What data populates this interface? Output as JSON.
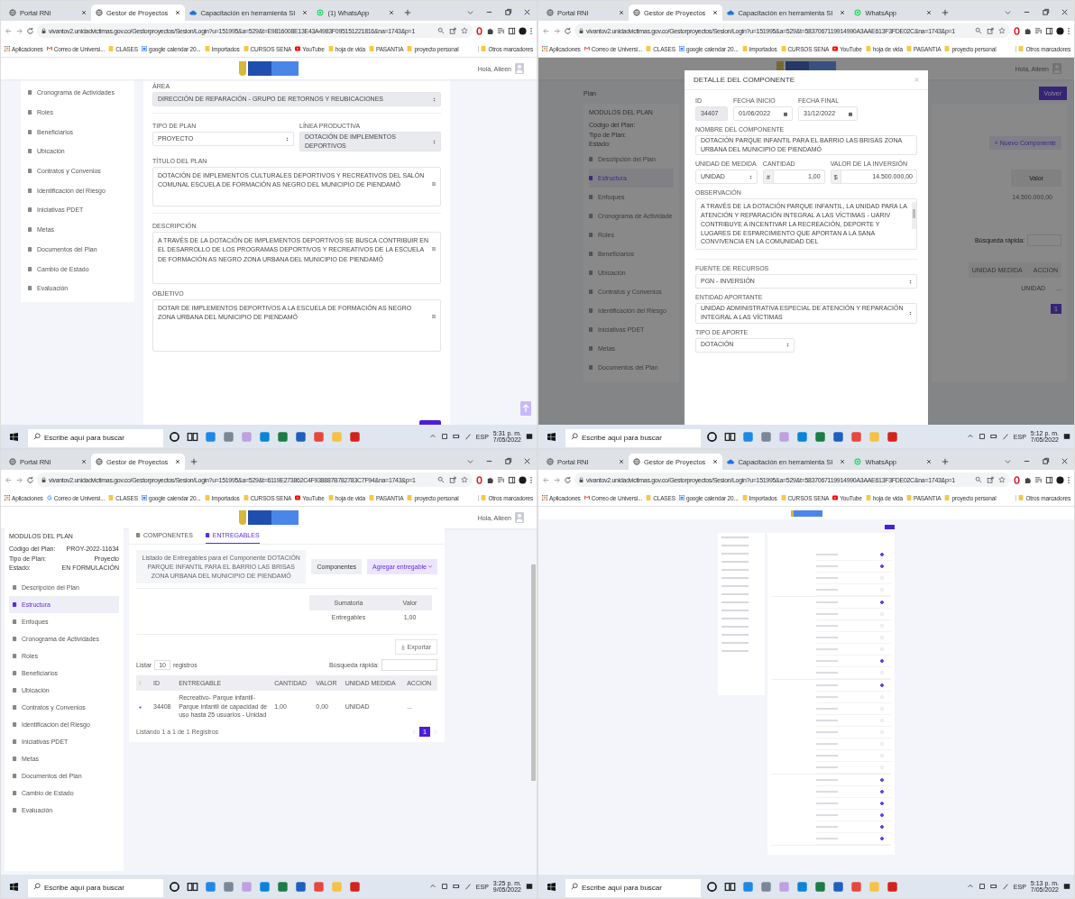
{
  "windows": [
    {
      "kind": "plan_form",
      "tabs": [
        {
          "label": "Portal RNI",
          "kind": "globe",
          "selected": false
        },
        {
          "label": "Gestor de Proyectos",
          "kind": "globe",
          "selected": true
        },
        {
          "label": "Capacitación en herramienta SI",
          "kind": "cloud",
          "selected": false
        },
        {
          "label": "(1) WhatsApp",
          "kind": "whatsapp",
          "selected": false
        }
      ],
      "url": "vivantov2.unidadvictimas.gov.co/Gestorproyectos/Sesion/Login?u=151995&a=529&t=E9816008E13E43A4983F095151221816&na=1743&p=1",
      "bookmarks": [
        {
          "label": "Aplicaciones",
          "kind": "apps"
        },
        {
          "label": "Correo de Universi...",
          "kind": "gmail"
        },
        {
          "label": "CLASES",
          "kind": "folder"
        },
        {
          "label": "google calendar 20...",
          "kind": "calendar"
        },
        {
          "label": "Importados",
          "kind": "folder"
        },
        {
          "label": "CURSOS SENA",
          "kind": "folder"
        },
        {
          "label": "YouTube",
          "kind": "youtube"
        },
        {
          "label": "hoja de vida",
          "kind": "folder"
        },
        {
          "label": "PASANTIA",
          "kind": "folder"
        },
        {
          "label": "proyecto personal",
          "kind": "folder"
        }
      ],
      "other_bookmarks": "Otros marcadores",
      "greeting": "Hola, Aileen",
      "sidebar": [
        {
          "label": "Cronograma de Actividades",
          "selected": false
        },
        {
          "label": "Roles",
          "selected": false
        },
        {
          "label": "Beneficiarios",
          "selected": false
        },
        {
          "label": "Ubicación",
          "selected": false
        },
        {
          "label": "Contratos y Convenios",
          "selected": false
        },
        {
          "label": "Identificación del Riesgo",
          "selected": false
        },
        {
          "label": "Iniciativas PDET",
          "selected": false
        },
        {
          "label": "Metas",
          "selected": false
        },
        {
          "label": "Documentos del Plan",
          "selected": false
        },
        {
          "label": "Cambio de Estado",
          "selected": false
        },
        {
          "label": "Evaluación",
          "selected": false
        }
      ],
      "form_rows": [
        [
          {
            "label": "ÁREA",
            "value": "DIRECCIÓN DE REPARACIÓN - GRUPO DE RETORNOS Y REUBICACIONES",
            "kind": "select",
            "disabled": true
          }
        ],
        [
          {
            "label": "TIPO DE PLAN",
            "value": "PROYECTO",
            "kind": "select",
            "disabled": false
          },
          {
            "label": "LÍNEA PRODUCTIVA",
            "value": "DOTACIÓN DE IMPLEMENTOS DEPORTIVOS",
            "kind": "select",
            "disabled": true
          }
        ],
        [
          {
            "label": "TÍTULO DEL PLAN",
            "value": "DOTACIÓN DE IMPLEMENTOS CULTURALES DEPORTIVOS Y RECREATIVOS DEL SALÓN COMUNAL ESCUELA DE FORMACIÓN AS NEGRO DEL MUNICIPIO DE PIENDAMÓ",
            "kind": "textarea",
            "disabled": false
          }
        ],
        [
          {
            "label": "DESCRIPCIÓN",
            "value": "A TRAVÉS DE LA DOTACIÓN DE IMPLEMENTOS DEPORTIVOS SE BUSCA CONTRIBUIR EN EL DESARROLLO DE LOS PROGRAMAS DEPORTIVOS Y RECREATIVOS DE LA ESCUELA DE FORMACIÓN AS NEGRO ZONA URBANA DEL MUNICIPIO DE PIENDAMÓ",
            "kind": "textarea",
            "disabled": false
          }
        ],
        [
          {
            "label": "OBJETIVO",
            "value": "DOTAR DE IMPLEMENTOS DEPORTIVOS A LA ESCUELA DE FORMACIÓN AS NEGRO ZONA URBANA DEL MUNICIPIO DE PIENDAMÓ",
            "kind": "textarea",
            "disabled": false
          }
        ]
      ],
      "taskbar": {
        "placeholder": "Escribe aquí para buscar",
        "lang": "ESP",
        "time": "5:31 p. m.",
        "date": "7/05/2022"
      }
    },
    {
      "kind": "component_modal",
      "tabs": [
        {
          "label": "Portal RNI",
          "kind": "globe",
          "selected": false
        },
        {
          "label": "Gestor de Proyectos",
          "kind": "globe",
          "selected": true
        },
        {
          "label": "Capacitación en herramienta SI",
          "kind": "cloud",
          "selected": false
        },
        {
          "label": "WhatsApp",
          "kind": "whatsapp",
          "selected": false
        }
      ],
      "url": "vivantov2.unidadvictimas.gov.co/Gestorproyectos/Sesion/Login?u=151995&a=529&t=5837067119914990A3AAE613F3FDE02C&na=1743&p=1",
      "bookmarks": [
        {
          "label": "Aplicaciones",
          "kind": "apps"
        },
        {
          "label": "Correo de Universi...",
          "kind": "gmail"
        },
        {
          "label": "CLASES",
          "kind": "folder"
        },
        {
          "label": "google calendar 20...",
          "kind": "calendar"
        },
        {
          "label": "Importados",
          "kind": "folder"
        },
        {
          "label": "CURSOS SENA",
          "kind": "folder"
        },
        {
          "label": "YouTube",
          "kind": "youtube"
        },
        {
          "label": "hoja de vida",
          "kind": "folder"
        },
        {
          "label": "PASANTIA",
          "kind": "folder"
        },
        {
          "label": "proyecto personal",
          "kind": "folder"
        }
      ],
      "other_bookmarks": "Otros marcadores",
      "greeting": "Hola, Aileen",
      "breadcrumb": "Plan",
      "sidebar_title": "MODULOS DEL PLAN",
      "meta_labels": [
        "Código del Plan:",
        "Tipo de Plan:",
        "Estado:"
      ],
      "sidebar": [
        {
          "label": "Descripción del Plan",
          "selected": false
        },
        {
          "label": "Estructura",
          "selected": true
        },
        {
          "label": "Enfoques",
          "selected": false
        },
        {
          "label": "Cronograma de Actividade",
          "selected": false
        },
        {
          "label": "Roles",
          "selected": false
        },
        {
          "label": "Beneficiarios",
          "selected": false
        },
        {
          "label": "Ubicación",
          "selected": false
        },
        {
          "label": "Contratos y Convenios",
          "selected": false
        },
        {
          "label": "Identificación del Riesgo",
          "selected": false
        },
        {
          "label": "Iniciativas PDET",
          "selected": false
        },
        {
          "label": "Metas",
          "selected": false
        },
        {
          "label": "Documentos del Plan",
          "selected": false
        }
      ],
      "back_button": "Volver",
      "new_button": "+ Nuevo Componente",
      "value_header": "Valor",
      "value_cell": "14.500.000,00",
      "search_label": "Búsqueda rápida:",
      "column_headers": [
        "UNIDAD MEDIDA",
        "ACCION"
      ],
      "row_cells": [
        "UNIDAD",
        "..."
      ],
      "page": "1",
      "modal": {
        "title": "DETALLE DEL COMPONENTE",
        "id": {
          "label": "ID",
          "value": "34407"
        },
        "start": {
          "label": "FECHA INICIO",
          "value": "01/06/2022"
        },
        "end": {
          "label": "FECHA FINAL",
          "value": "31/12/2022"
        },
        "name": {
          "label": "NOMBRE DEL COMPONENTE",
          "value": "DOTACIÓN PARQUE INFANTIL PARA EL BARRIO LAS BRISAS ZONA URBANA DEL MUNICIPIO DE PIENDAMÓ"
        },
        "unit": {
          "label": "UNIDAD DE MEDIDA",
          "value": "UNIDAD"
        },
        "qty": {
          "label": "CANTIDAD",
          "prefix": "#",
          "value": "1,00"
        },
        "amount": {
          "label": "VALOR DE LA INVERSIÓN",
          "prefix": "$",
          "value": "14.500.000,00"
        },
        "observation": {
          "label": "OBSERVACIÓN",
          "value": "A TRAVÉS DE LA DOTACIÓN PARQUE INFANTIL, LA UNIDAD PARA LA ATENCIÓN Y REPARACIÓN INTEGRAL A LAS VÍCTIMAS - UARIV CONTRIBUYE A INCENTIVAR LA RECREACIÓN, DEPORTE Y LUGARES DE ESPARCIMIENTO QUE APORTAN A LA SANA CONVIVENCIA EN LA COMUNIDAD DEL"
        },
        "source": {
          "label": "FUENTE DE RECURSOS",
          "value": "PGN - INVERSIÓN"
        },
        "entity": {
          "label": "ENTIDAD APORTANTE",
          "value": "UNIDAD ADMINISTRATIVA ESPECIAL DE ATENCIÓN Y REPARACIÓN INTEGRAL A LAS VÍCTIMAS"
        },
        "contribution": {
          "label": "TIPO DE APORTE",
          "value": "DOTACIÓN"
        }
      },
      "taskbar": {
        "placeholder": "Escribe aquí para buscar",
        "lang": "ESP",
        "time": "5:12 p. m.",
        "date": "7/05/2022"
      }
    },
    {
      "kind": "deliverables",
      "tabs": [
        {
          "label": "Portal RNI",
          "kind": "globe",
          "selected": false
        },
        {
          "label": "Gestor de Proyectos",
          "kind": "globe",
          "selected": true
        }
      ],
      "url": "vivantov2.unidadvictimas.gov.co/Gestorproyectos/Sesion/Login?u=151995&a=529&t=6119E273862C4F938887B782783C7F94&na=1743&p=1",
      "bookmarks": [
        {
          "label": "Aplicaciones",
          "kind": "apps"
        },
        {
          "label": "Correo de Universi...",
          "kind": "google"
        },
        {
          "label": "CLASES",
          "kind": "folder"
        },
        {
          "label": "google calendar 20...",
          "kind": "calendar"
        },
        {
          "label": "Importados",
          "kind": "folder"
        },
        {
          "label": "CURSOS SENA",
          "kind": "folder"
        },
        {
          "label": "YouTube",
          "kind": "youtube"
        },
        {
          "label": "hoja de vida",
          "kind": "folder"
        },
        {
          "label": "PASANTIA",
          "kind": "folder"
        },
        {
          "label": "proyecto personal",
          "kind": "folder"
        }
      ],
      "other_bookmarks": "Otros marcadores",
      "greeting": "Hola, Aileen",
      "sidebar_title": "MODULOS DEL PLAN",
      "meta": [
        {
          "label": "Código del Plan:",
          "value": "PROY-2022-11634"
        },
        {
          "label": "Tipo de Plan:",
          "value": "Proyecto"
        },
        {
          "label": "Estado:",
          "value": "EN FORMULACIÓN"
        }
      ],
      "sidebar": [
        {
          "label": "Descripción del Plan",
          "selected": false
        },
        {
          "label": "Estructura",
          "selected": true
        },
        {
          "label": "Enfoques",
          "selected": false
        },
        {
          "label": "Cronograma de Actividades",
          "selected": false
        },
        {
          "label": "Roles",
          "selected": false
        },
        {
          "label": "Beneficiarios",
          "selected": false
        },
        {
          "label": "Ubicación",
          "selected": false
        },
        {
          "label": "Contratos y Convenios",
          "selected": false
        },
        {
          "label": "Identificación del Riesgo",
          "selected": false
        },
        {
          "label": "Iniciativas PDET",
          "selected": false
        },
        {
          "label": "Metas",
          "selected": false
        },
        {
          "label": "Documentos del Plan",
          "selected": false
        },
        {
          "label": "Cambio de Estado",
          "selected": false
        },
        {
          "label": "Evaluación",
          "selected": false
        }
      ],
      "content_tabs": [
        {
          "label": "COMPONENTES",
          "selected": false
        },
        {
          "label": "ENTREGABLES",
          "selected": true
        }
      ],
      "info": "Listado de Entregables para el Componente DOTACIÓN PARQUE INFANTIL PARA EL BARRIO LAS BRISAS ZONA URBANA DEL MUNICIPIO DE PIENDAMÓ",
      "components_button": "Componentes",
      "add_button": "Agregar entregable",
      "summary": {
        "columns": [
          "Sumatoria",
          "Valor"
        ],
        "row": [
          "Entregables",
          "1,00"
        ]
      },
      "export_button": "Exportar",
      "list_before": "Listar",
      "page_size": "10",
      "list_after": "registros",
      "search_label": "Búsqueda rápida:",
      "table": {
        "columns": [
          "ID",
          "ENTREGABLE",
          "CANTIDAD",
          "VALOR",
          "UNIDAD MEDIDA",
          "ACCION"
        ],
        "rows": [
          [
            "34408",
            "Recreativo- Parque infantil- Parque infantil de capacidad de uso hasta 25 usuarios - Unidad",
            "1,00",
            "0,00",
            "UNIDAD",
            "..."
          ]
        ]
      },
      "footer": "Listando 1 a 1 de 1 Registros",
      "page": "1",
      "taskbar": {
        "placeholder": "Escribe aquí para buscar",
        "lang": "ESP",
        "time": "3:25 p. m.",
        "date": "9/05/2022"
      }
    },
    {
      "kind": "zoomed_out",
      "tabs": [
        {
          "label": "Portal RNI",
          "kind": "globe",
          "selected": false
        },
        {
          "label": "Gestor de Proyectos",
          "kind": "globe",
          "selected": true
        },
        {
          "label": "Capacitación en herramienta SI",
          "kind": "cloud",
          "selected": false
        },
        {
          "label": "WhatsApp",
          "kind": "whatsapp",
          "selected": false
        }
      ],
      "url": "vivantov2.unidadvictimas.gov.co/Gestorproyectos/Sesion/Login?u=151995&a=529&t=5837067119914990A3AAE613F3FDE02C&na=1743&p=1",
      "bookmarks": [
        {
          "label": "Aplicaciones",
          "kind": "apps"
        },
        {
          "label": "Correo de Universi...",
          "kind": "gmail"
        },
        {
          "label": "CLASES",
          "kind": "folder"
        },
        {
          "label": "google calendar 20...",
          "kind": "calendar"
        },
        {
          "label": "Importados",
          "kind": "folder"
        },
        {
          "label": "CURSOS SENA",
          "kind": "folder"
        },
        {
          "label": "YouTube",
          "kind": "youtube"
        },
        {
          "label": "hoja de vida",
          "kind": "folder"
        },
        {
          "label": "PASANTIA",
          "kind": "folder"
        },
        {
          "label": "proyecto personal",
          "kind": "folder"
        }
      ],
      "other_bookmarks": "Otros marcadores",
      "toggle_groups": [
        [
          {
            "on": true
          },
          {
            "on": true
          },
          {
            "on": false
          },
          {
            "on": false
          }
        ],
        [
          {
            "on": true
          },
          {
            "on": false
          },
          {
            "on": false
          },
          {
            "on": false
          },
          {
            "on": false
          },
          {
            "on": true
          },
          {
            "on": false
          }
        ],
        [
          {
            "on": true
          },
          {
            "on": false
          },
          {
            "on": false
          },
          {
            "on": false
          },
          {
            "on": false
          },
          {
            "on": false
          },
          {
            "on": false
          },
          {
            "on": false
          }
        ],
        [
          {
            "on": true
          },
          {
            "on": true
          },
          {
            "on": true
          },
          {
            "on": true
          },
          {
            "on": true
          },
          {
            "on": true
          }
        ]
      ],
      "taskbar": {
        "placeholder": "Escribe aquí para buscar",
        "lang": "ESP",
        "time": "5:13 p. m.",
        "date": "7/05/2022"
      }
    }
  ]
}
